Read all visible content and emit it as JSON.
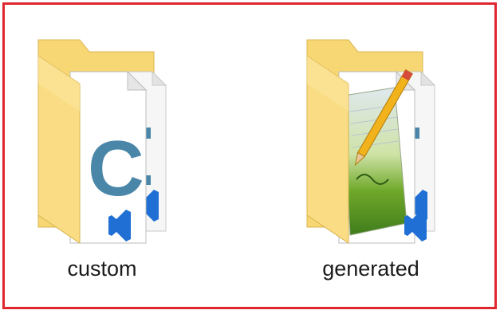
{
  "folders": [
    {
      "label": "custom",
      "icon": "folder-with-c-source-files-icon",
      "overlay_glyph": "C",
      "accent_color": "#4a86a8",
      "vs_icon_color": "#1f6fd4"
    },
    {
      "label": "generated",
      "icon": "folder-with-generated-files-icon",
      "overlay_glyph": "",
      "accent_color": "#6fa82a",
      "vs_icon_color": "#1f6fd4"
    }
  ],
  "highlight_color": "#e0262f"
}
